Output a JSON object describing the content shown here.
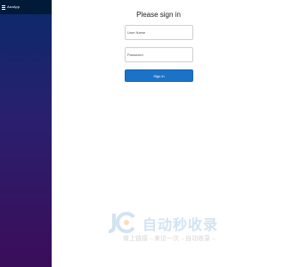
{
  "app": {
    "title": "AsnApp"
  },
  "form": {
    "heading": "Please sign in",
    "username": {
      "placeholder": "User Name",
      "value": ""
    },
    "password": {
      "placeholder": "Password",
      "value": ""
    },
    "submit_label": "Sign in"
  },
  "watermark": {
    "title": "自动秒收录",
    "subtitle": "做上链接→来访一次→自动收录→"
  },
  "colors": {
    "topbar": "#001a38",
    "sidebar_top": "#0a2a6b",
    "sidebar_bottom": "#3b0d5a",
    "primary": "#1b73c8"
  }
}
